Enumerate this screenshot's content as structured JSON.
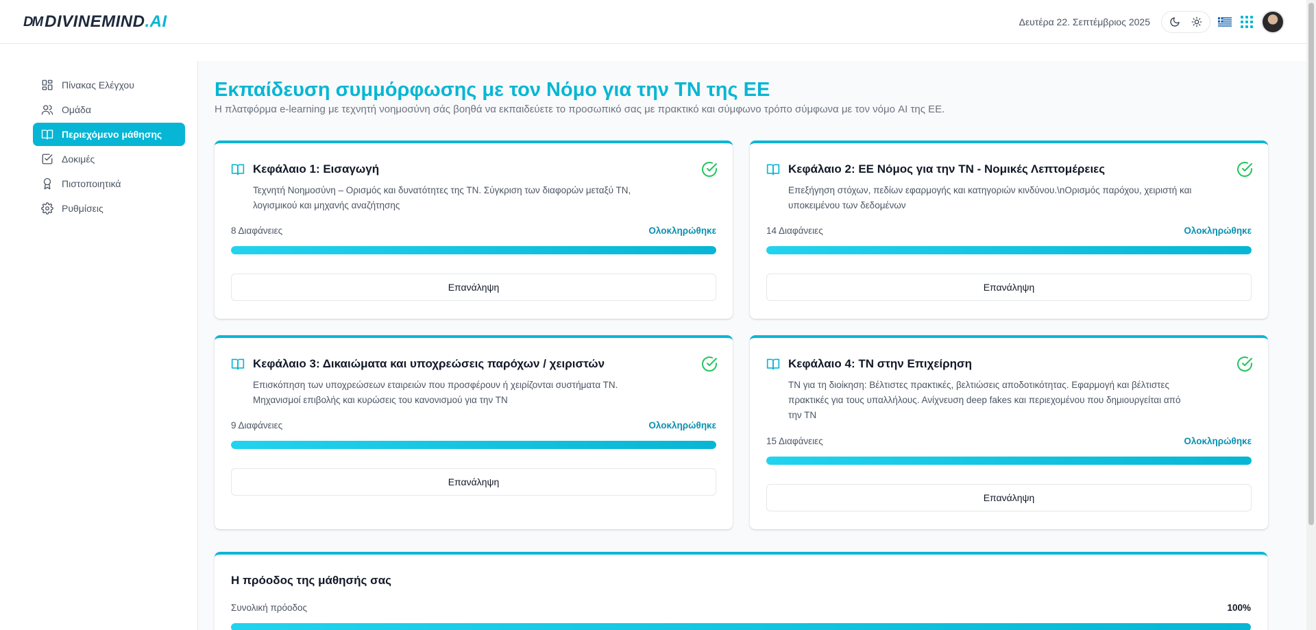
{
  "header": {
    "logo_mark": "DM",
    "logo_text": "DIVINEMIND",
    "logo_suffix": ".AI",
    "date": "Δευτέρα 22. Σεπτέμβριος 2025"
  },
  "sidebar": {
    "items": [
      {
        "label": "Πίνακας Ελέγχου",
        "icon": "dashboard-icon"
      },
      {
        "label": "Ομάδα",
        "icon": "users-icon"
      },
      {
        "label": "Περιεχόμενο μάθησης",
        "icon": "book-icon",
        "active": true
      },
      {
        "label": "Δοκιμές",
        "icon": "checkbox-icon"
      },
      {
        "label": "Πιστοποιητικά",
        "icon": "award-icon"
      },
      {
        "label": "Ρυθμίσεις",
        "icon": "gear-icon"
      }
    ]
  },
  "main": {
    "title": "Εκπαίδευση συμμόρφωσης με τον Νόμο για την ΤΝ της ΕΕ",
    "subtitle": "Η πλατφόρμα e-learning με τεχνητή νοημοσύνη σάς βοηθά να εκπαιδεύετε το προσωπικό σας με πρακτικό και σύμφωνο τρόπο σύμφωνα με τον νόμο AI της ΕΕ.",
    "chapters": [
      {
        "title": "Κεφάλαιο 1: Εισαγωγή",
        "description": "Τεχνητή Νοημοσύνη – Ορισμός και δυνατότητες της ΤΝ. Σύγκριση των διαφορών μεταξύ ΤΝ, λογισμικού και μηχανής αναζήτησης",
        "slides": "8 Διαφάνειες",
        "status": "Ολοκληρώθηκε",
        "progress": 100,
        "button": "Επανάληψη"
      },
      {
        "title": "Κεφάλαιο 2: ΕΕ Νόμος για την ΤΝ - Νομικές Λεπτομέρειες",
        "description": "Επεξήγηση στόχων, πεδίων εφαρμογής και κατηγοριών κινδύνου.\\nΟρισμός παρόχου, χειριστή και υποκειμένου των δεδομένων",
        "slides": "14 Διαφάνειες",
        "status": "Ολοκληρώθηκε",
        "progress": 100,
        "button": "Επανάληψη"
      },
      {
        "title": "Κεφάλαιο 3: Δικαιώματα και υποχρεώσεις παρόχων / χειριστών",
        "description": "Επισκόπηση των υποχρεώσεων εταιρειών που προσφέρουν ή χειρίζονται συστήματα ΤΝ. Μηχανισμοί επιβολής και κυρώσεις του κανονισμού για την ΤΝ",
        "slides": "9 Διαφάνειες",
        "status": "Ολοκληρώθηκε",
        "progress": 100,
        "button": "Επανάληψη"
      },
      {
        "title": "Κεφάλαιο 4: ΤΝ στην Επιχείρηση",
        "description": "ΤΝ για τη διοίκηση: Βέλτιστες πρακτικές, βελτιώσεις αποδοτικότητας. Εφαρμογή και βέλτιστες πρακτικές για τους υπαλλήλους. Ανίχνευση deep fakes και περιεχομένου που δημιουργείται από την ΤΝ",
        "slides": "15 Διαφάνειες",
        "status": "Ολοκληρώθηκε",
        "progress": 100,
        "button": "Επανάληψη"
      }
    ],
    "progress": {
      "title": "Η πρόοδος της μάθησής σας",
      "label": "Συνολική πρόοδος",
      "value": "100%",
      "fraction": 1.0
    }
  },
  "colors": {
    "accent": "#06b6d4",
    "success": "#22c55e"
  }
}
